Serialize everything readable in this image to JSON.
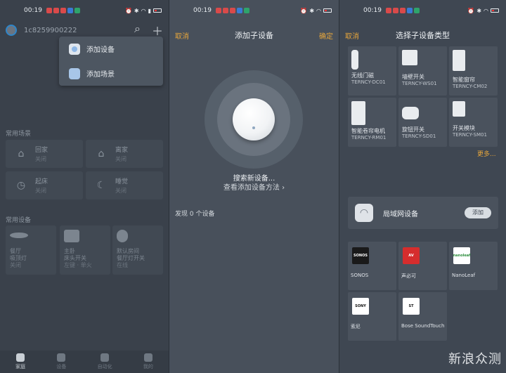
{
  "status_bar": {
    "time": "00:19"
  },
  "home": {
    "id_label": "1c8259900222",
    "menu": [
      {
        "label": "添加设备",
        "icon": "device-icon"
      },
      {
        "label": "添加场景",
        "icon": "scene-icon"
      }
    ],
    "scenes_title": "常用场景",
    "scenes": [
      {
        "name": "回家",
        "state": "关闭",
        "icon": "home-person-icon"
      },
      {
        "name": "离家",
        "state": "关闭",
        "icon": "house-leave-icon"
      },
      {
        "name": "起床",
        "state": "关闭",
        "icon": "alarm-clock-icon"
      },
      {
        "name": "睡觉",
        "state": "关闭",
        "icon": "moon-icon"
      }
    ],
    "devices_title": "常用设备",
    "devices": [
      {
        "line1": "餐厅",
        "line2": "吸顶灯",
        "line3": "关闭"
      },
      {
        "line1": "主卧",
        "line2": "床头开关",
        "line3": "左键 · 单火"
      },
      {
        "line1": "默认房间",
        "line2": "餐厅灯开关",
        "line3": "在线"
      }
    ],
    "nav": [
      "家庭",
      "设备",
      "自动化",
      "我的"
    ]
  },
  "add_sub": {
    "cancel": "取消",
    "title": "添加子设备",
    "confirm": "确定",
    "searching": "搜索新设备...",
    "howto": "查看添加设备方法 ›",
    "found": "发现 0 个设备"
  },
  "select_type": {
    "cancel": "取消",
    "title": "选择子设备类型",
    "types": [
      {
        "name": "无线门磁",
        "model": "TERNCY-DC01"
      },
      {
        "name": "墙壁开关",
        "model": "TERNCY-WS01"
      },
      {
        "name": "智能窗帘",
        "model": "TERNCY-CM02"
      },
      {
        "name": "智能卷帘电机",
        "model": "TERNCY-RM01"
      },
      {
        "name": "旋钮开关",
        "model": "TERNCY-SD01"
      },
      {
        "name": "开关模块",
        "model": "TERNCY-SM01"
      }
    ],
    "more": "更多...",
    "lan_label": "局域网设备",
    "add_label": "添加",
    "brands": [
      {
        "name": "SONOS",
        "logo_text": "SONOS",
        "bg": "#1a1a1a",
        "fg": "#ffffff"
      },
      {
        "name": "声必可",
        "logo_text": "AV",
        "bg": "#d62d2d",
        "fg": "#ffffff"
      },
      {
        "name": "NanoLeaf",
        "logo_text": "nanoleaf",
        "bg": "#ffffff",
        "fg": "#2f8f3f"
      },
      {
        "name": "索尼",
        "logo_text": "SONY",
        "bg": "#ffffff",
        "fg": "#111111"
      },
      {
        "name": "Bose SoundTouch",
        "logo_text": "ST",
        "bg": "#ffffff",
        "fg": "#111111"
      }
    ],
    "watermark": "新浪众测"
  }
}
